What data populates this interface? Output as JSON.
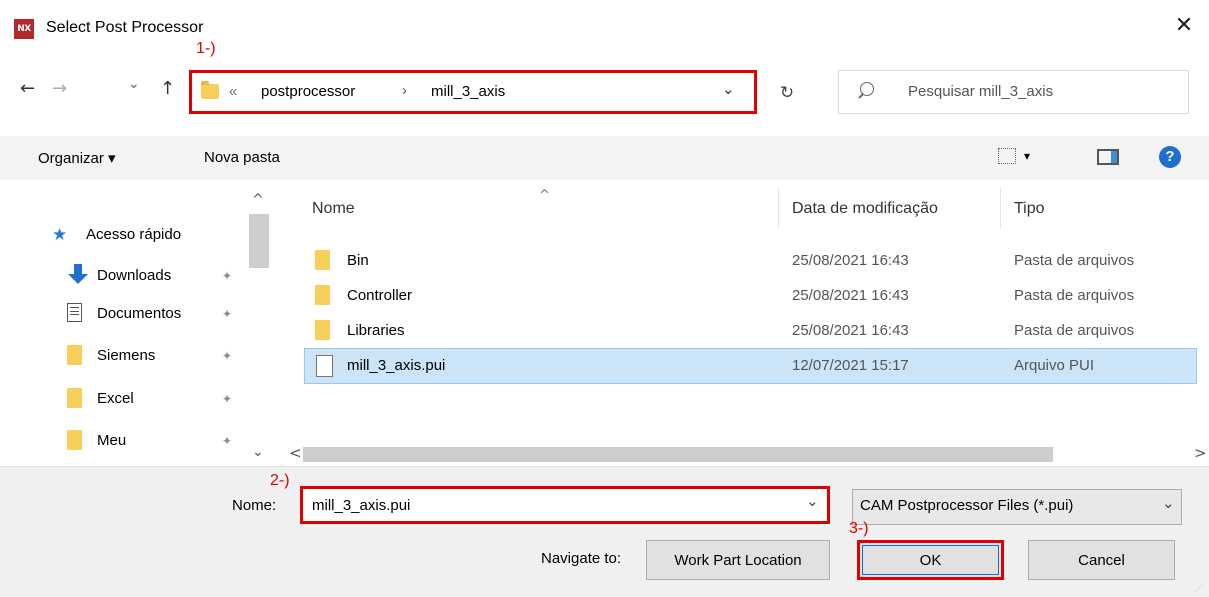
{
  "window": {
    "title": "Select Post Processor",
    "app_icon_text": "NX",
    "close_glyph": "✕"
  },
  "annotations": {
    "step1": "1-)",
    "step2": "2-)",
    "step3": "3-)"
  },
  "nav": {
    "back_glyph": "←",
    "forward_glyph": "→",
    "recent_glyph": "⌄",
    "up_glyph": "↑",
    "address": {
      "overflow": "«",
      "crumbs": [
        "postprocessor",
        "mill_3_axis"
      ],
      "sep": "›",
      "dropdown_glyph": "⌄"
    },
    "refresh_glyph": "↻",
    "search": {
      "placeholder": "Pesquisar mill_3_axis"
    }
  },
  "toolbar": {
    "organize": "Organizar ▾",
    "new_folder": "Nova pasta",
    "view_dropdown": "▾",
    "help": "?"
  },
  "sidebar": {
    "quick_access": "Acesso rápido",
    "items": [
      {
        "label": "Downloads",
        "icon": "download-arrow-icon"
      },
      {
        "label": "Documentos",
        "icon": "documents-icon"
      },
      {
        "label": "Siemens",
        "icon": "folder-icon"
      },
      {
        "label": "Excel",
        "icon": "folder-icon"
      },
      {
        "label": "Meu",
        "icon": "folder-icon"
      }
    ],
    "pin_glyph": "📌",
    "scroll_up": "^",
    "scroll_down": "⌄"
  },
  "file_list": {
    "sort_glyph": "^",
    "columns": {
      "name": "Nome",
      "date": "Data de modificação",
      "type": "Tipo"
    },
    "rows": [
      {
        "name": "Bin",
        "date": "25/08/2021 16:43",
        "type": "Pasta de arquivos",
        "icon": "folder-icon",
        "selected": false
      },
      {
        "name": "Controller",
        "date": "25/08/2021 16:43",
        "type": "Pasta de arquivos",
        "icon": "folder-icon",
        "selected": false
      },
      {
        "name": "Libraries",
        "date": "25/08/2021 16:43",
        "type": "Pasta de arquivos",
        "icon": "folder-icon",
        "selected": false
      },
      {
        "name": "mill_3_axis.pui",
        "date": "12/07/2021 15:17",
        "type": "Arquivo PUI",
        "icon": "file-icon",
        "selected": true
      }
    ],
    "scroll_left": "<",
    "scroll_right": ">"
  },
  "bottom": {
    "filename_label": "Nome:",
    "filename_value": "mill_3_axis.pui",
    "filename_dropdown": "⌄",
    "filter_value": "CAM Postprocessor Files (*.pui)",
    "filter_dropdown": "⌄",
    "navigate_label": "Navigate to:",
    "navigate_button": "Work Part Location",
    "ok_button": "OK",
    "cancel_button": "Cancel"
  },
  "colors": {
    "highlight_red": "#e00000",
    "selection_blue": "#cce4f7",
    "folder_yellow": "#f7cf5b",
    "app_icon_red": "#b2282b"
  }
}
